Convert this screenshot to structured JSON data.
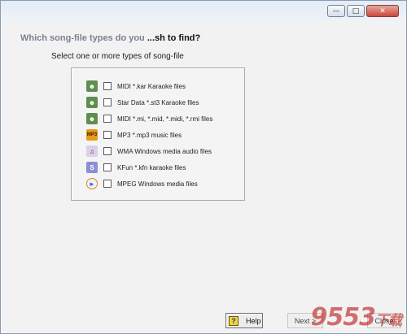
{
  "window": {
    "minimize_icon": "minimize-icon",
    "maximize_icon": "maximize-icon",
    "close_icon": "close-icon"
  },
  "heading_faded": "Which song-file types do you ",
  "heading_visible": "...sh to find?",
  "subheading": "Select one or more types of song-file",
  "file_types": [
    {
      "label": "MIDI *.kar Karaoke files",
      "icon": "karaoke-person-icon",
      "checked": false
    },
    {
      "label": "Star Data *.st3 Karaoke files",
      "icon": "karaoke-person-icon",
      "checked": false
    },
    {
      "label": "MIDI *.mi, *.mid, *.midi, *.rmi files",
      "icon": "karaoke-person-icon",
      "checked": false
    },
    {
      "label": "MP3 *.mp3 music files",
      "icon": "mp3-icon",
      "checked": false
    },
    {
      "label": "WMA Windows media audio files",
      "icon": "wma-icon",
      "checked": false
    },
    {
      "label": "KFun *.kfn karaoke files",
      "icon": "kfun-icon",
      "checked": false
    },
    {
      "label": "MPEG  Windows media  files",
      "icon": "mpeg-icon",
      "checked": false
    }
  ],
  "buttons": {
    "help_label": "Help",
    "help_icon_glyph": "?",
    "next_label": "Next >",
    "cancel_label": "Close"
  },
  "watermark": {
    "text": "9553",
    "suffix": "下载"
  }
}
